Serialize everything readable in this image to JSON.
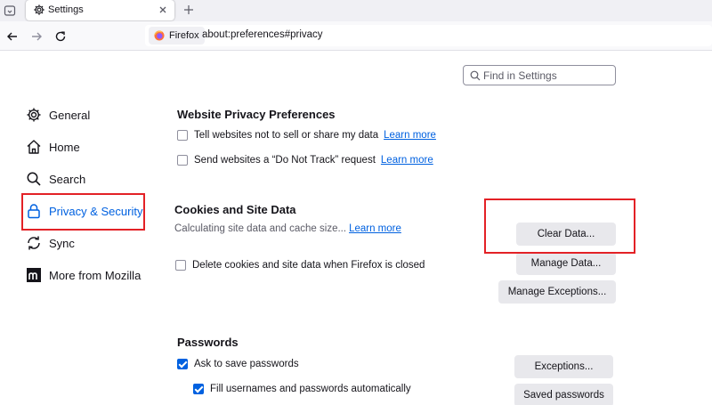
{
  "browser": {
    "tab_title": "Settings",
    "identity_label": "Firefox",
    "url": "about:preferences#privacy",
    "icons": {
      "tab_overview": "tab-overview-icon",
      "tab": "gear-icon",
      "close": "close-icon",
      "new_tab": "plus-icon",
      "back": "back-arrow-icon",
      "forward": "forward-arrow-icon",
      "reload": "reload-icon",
      "identity": "firefox-logo-icon"
    }
  },
  "search": {
    "placeholder": "Find in Settings",
    "value": ""
  },
  "sidebar": {
    "items": [
      {
        "label": "General",
        "icon": "gear-icon",
        "selected": false
      },
      {
        "label": "Home",
        "icon": "home-icon",
        "selected": false
      },
      {
        "label": "Search",
        "icon": "search-icon",
        "selected": false
      },
      {
        "label": "Privacy & Security",
        "icon": "lock-icon",
        "selected": true
      },
      {
        "label": "Sync",
        "icon": "sync-icon",
        "selected": false
      },
      {
        "label": "More from Mozilla",
        "icon": "mozilla-icon",
        "selected": false
      }
    ]
  },
  "website_privacy": {
    "heading": "Website Privacy Preferences",
    "options": [
      {
        "label": "Tell websites not to sell or share my data",
        "checked": false,
        "link": "Learn more"
      },
      {
        "label": "Send websites a “Do Not Track” request",
        "checked": false,
        "link": "Learn more"
      }
    ]
  },
  "cookies": {
    "heading": "Cookies and Site Data",
    "status": "Calculating site data and cache size...",
    "link": "Learn more",
    "delete_option": {
      "label": "Delete cookies and site data when Firefox is closed",
      "checked": false
    },
    "buttons": {
      "clear": "Clear Data...",
      "manage": "Manage Data...",
      "exceptions": "Manage Exceptions..."
    }
  },
  "passwords": {
    "heading": "Passwords",
    "ask_save": {
      "label": "Ask to save passwords",
      "checked": true
    },
    "autofill": {
      "label": "Fill usernames and passwords automatically",
      "checked": true
    },
    "buttons": {
      "exceptions": "Exceptions...",
      "saved": "Saved passwords"
    }
  },
  "colors": {
    "accent": "#0061e0",
    "highlight": "#e32126",
    "button_bg": "#e8e8ec"
  }
}
